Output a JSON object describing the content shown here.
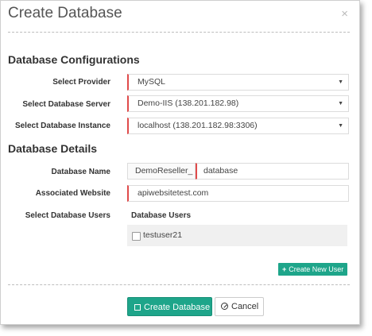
{
  "dialog": {
    "title": "Create Database",
    "close": "×"
  },
  "config": {
    "heading": "Database Configurations",
    "provider": {
      "label": "Select Provider",
      "value": "MySQL"
    },
    "server": {
      "label": "Select Database Server",
      "value": "Demo-IIS (138.201.182.98)"
    },
    "instance": {
      "label": "Select Database Instance",
      "value": "localhost (138.201.182.98:3306)"
    }
  },
  "details": {
    "heading": "Database Details",
    "name": {
      "label": "Database Name",
      "prefix": "DemoReseller_",
      "value": "database"
    },
    "website": {
      "label": "Associated Website",
      "value": "apiwebsitetest.com"
    },
    "users": {
      "label": "Select Database Users",
      "title": "Database Users",
      "items": [
        {
          "label": "testuser21",
          "checked": false
        }
      ]
    },
    "create_user_button": "Create New User"
  },
  "footer": {
    "create_button": "Create Database",
    "cancel_button": "Cancel"
  },
  "colors": {
    "accent": "#1ea58a",
    "required": "#e04b4b"
  }
}
